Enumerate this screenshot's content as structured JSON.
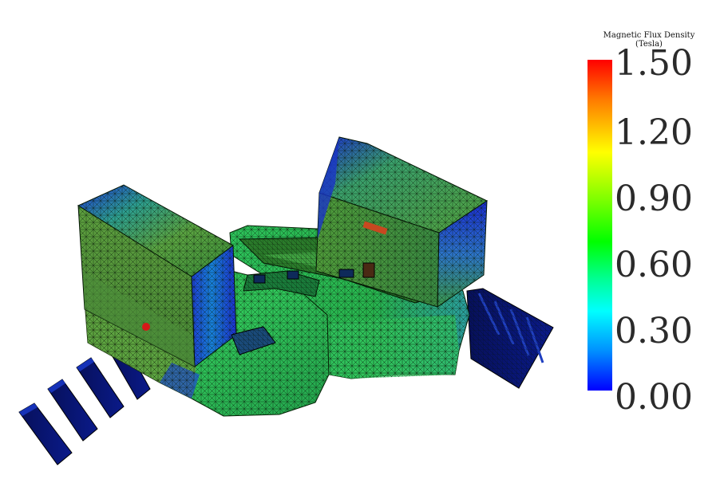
{
  "legend": {
    "title": "Magnetic Flux Density",
    "unit": "(Tesla)",
    "ticks": [
      "1.50",
      "1.20",
      "0.90",
      "0.60",
      "0.30",
      "0.00"
    ],
    "min": 0.0,
    "max": 1.5,
    "colormap": [
      "#0000ff",
      "#0090ff",
      "#00ffff",
      "#00ff90",
      "#00ff00",
      "#80ff00",
      "#ffff00",
      "#ff7a00",
      "#ff0000"
    ]
  },
  "colors": {
    "low": "#0000ff",
    "mid": "#2fd24a",
    "high": "#ff0000",
    "mesh_line": "#0a1a0a"
  }
}
